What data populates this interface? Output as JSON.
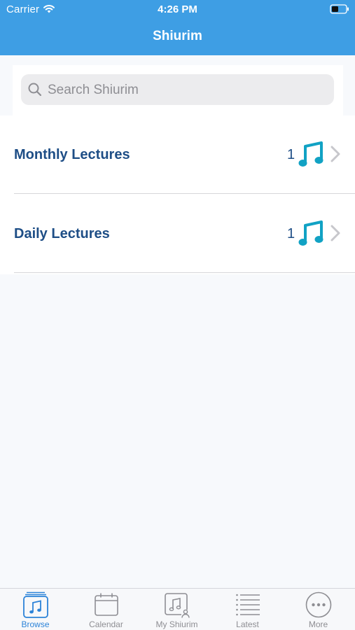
{
  "status_bar": {
    "carrier": "Carrier",
    "time": "4:26 PM",
    "icons": [
      "wifi-icon",
      "battery-icon"
    ]
  },
  "nav": {
    "title": "Shiurim"
  },
  "search": {
    "placeholder": "Search Shiurim",
    "value": ""
  },
  "list": {
    "items": [
      {
        "label": "Monthly Lectures",
        "count": "1",
        "icon": "music-note-icon"
      },
      {
        "label": "Daily Lectures",
        "count": "1",
        "icon": "music-note-icon"
      }
    ]
  },
  "tabs": [
    {
      "label": "Browse",
      "icon": "browse-icon",
      "active": true
    },
    {
      "label": "Calendar",
      "icon": "calendar-icon",
      "active": false
    },
    {
      "label": "My Shiurim",
      "icon": "my-shiurim-icon",
      "active": false
    },
    {
      "label": "Latest",
      "icon": "list-icon",
      "active": false
    },
    {
      "label": "More",
      "icon": "more-icon",
      "active": false
    }
  ],
  "colors": {
    "header": "#3e9ee4",
    "accent": "#2c83d8",
    "row_text": "#1e4e86",
    "music_icon": "#11a2c4",
    "inactive_tab": "#8e8e93"
  }
}
